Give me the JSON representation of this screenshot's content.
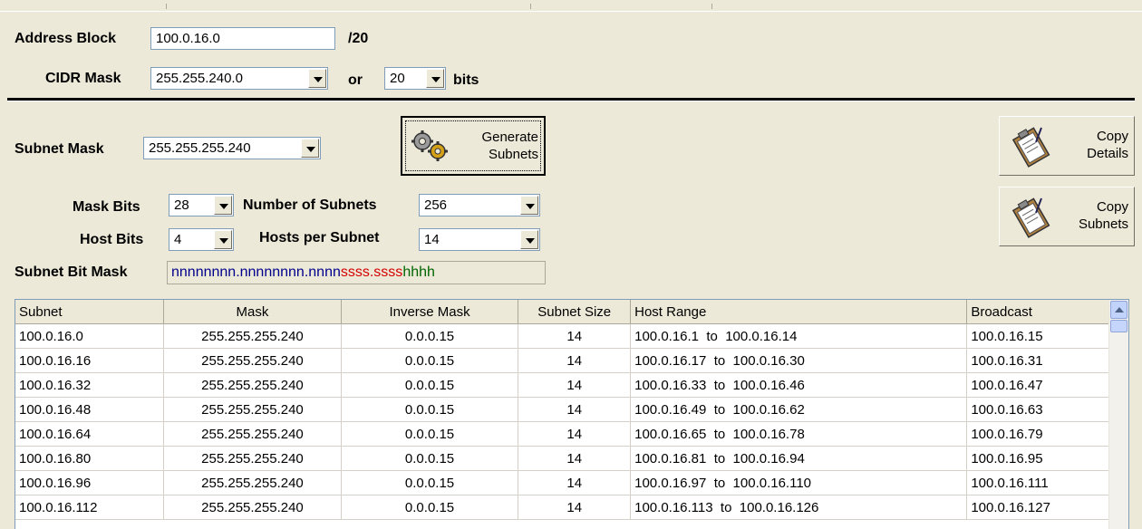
{
  "address_block": {
    "label": "Address Block",
    "value": "100.0.16.0",
    "prefix": "/20"
  },
  "cidr_mask": {
    "label": "CIDR Mask",
    "value": "255.255.240.0",
    "or_label": "or",
    "bits_value": "20",
    "bits_label": "bits"
  },
  "subnet_mask": {
    "label": "Subnet Mask",
    "value": "255.255.255.240"
  },
  "generate_button": {
    "line1": "Generate",
    "line2": "Subnets"
  },
  "copy_details_button": {
    "line1": "Copy",
    "line2": "Details"
  },
  "copy_subnets_button": {
    "line1": "Copy",
    "line2": "Subnets"
  },
  "mask_bits": {
    "label": "Mask Bits",
    "value": "28"
  },
  "host_bits": {
    "label": "Host Bits",
    "value": "4"
  },
  "num_subnets": {
    "label": "Number of Subnets",
    "value": "256"
  },
  "hosts_per_subnet": {
    "label": "Hosts per Subnet",
    "value": "14"
  },
  "subnet_bit_mask": {
    "label": "Subnet Bit Mask",
    "network_part": "nnnnnnnn.nnnnnnnn.nnnn",
    "subnet_part": "ssss.ssss",
    "host_part": "hhhh",
    "colors": {
      "network": "#00008b",
      "subnet": "#d40000",
      "host": "#006400"
    }
  },
  "table": {
    "columns": [
      "Subnet",
      "Mask",
      "Inverse Mask",
      "Subnet Size",
      "Host Range",
      "Broadcast"
    ],
    "rows": [
      [
        "100.0.16.0",
        "255.255.255.240",
        "0.0.0.15",
        "14",
        "100.0.16.1  to  100.0.16.14",
        "100.0.16.15"
      ],
      [
        "100.0.16.16",
        "255.255.255.240",
        "0.0.0.15",
        "14",
        "100.0.16.17  to  100.0.16.30",
        "100.0.16.31"
      ],
      [
        "100.0.16.32",
        "255.255.255.240",
        "0.0.0.15",
        "14",
        "100.0.16.33  to  100.0.16.46",
        "100.0.16.47"
      ],
      [
        "100.0.16.48",
        "255.255.255.240",
        "0.0.0.15",
        "14",
        "100.0.16.49  to  100.0.16.62",
        "100.0.16.63"
      ],
      [
        "100.0.16.64",
        "255.255.255.240",
        "0.0.0.15",
        "14",
        "100.0.16.65  to  100.0.16.78",
        "100.0.16.79"
      ],
      [
        "100.0.16.80",
        "255.255.255.240",
        "0.0.0.15",
        "14",
        "100.0.16.81  to  100.0.16.94",
        "100.0.16.95"
      ],
      [
        "100.0.16.96",
        "255.255.255.240",
        "0.0.0.15",
        "14",
        "100.0.16.97  to  100.0.16.110",
        "100.0.16.111"
      ],
      [
        "100.0.16.112",
        "255.255.255.240",
        "0.0.0.15",
        "14",
        "100.0.16.113  to  100.0.16.126",
        "100.0.16.127"
      ]
    ]
  },
  "icons": {
    "generate": "gears-icon",
    "copy": "clipboard-icon",
    "dropdown": "chevron-down-icon",
    "scroll_up": "scroll-up-arrow-icon"
  }
}
